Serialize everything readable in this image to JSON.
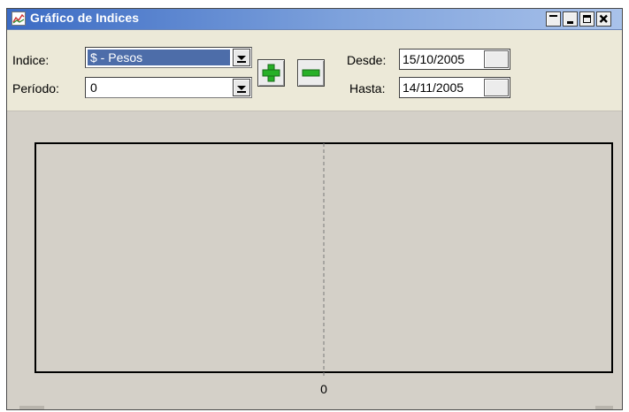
{
  "window": {
    "title": "Gráfico de Indices",
    "icon": "chart-icon"
  },
  "titlebar_buttons": [
    "restore-down-icon",
    "minimize-icon",
    "maximize-icon",
    "close-icon"
  ],
  "form": {
    "indice_label": "Indice:",
    "indice_value": "$ - Pesos",
    "periodo_label": "Período:",
    "periodo_value": "0",
    "add_icon": "plus-icon",
    "remove_icon": "minus-icon",
    "desde_label": "Desde:",
    "desde_value": "15/10/2005",
    "hasta_label": "Hasta:",
    "hasta_value": "14/11/2005"
  },
  "colors": {
    "titlebar_start": "#3b6bc4",
    "combo_selected": "#4d6da9",
    "button_icon_green": "#28b028",
    "chart_background": "#d4d0c8"
  },
  "chart_data": {
    "type": "line",
    "title": "",
    "xlabel": "",
    "ylabel": "",
    "x_ticks": [
      "0"
    ],
    "series": [],
    "grid": false,
    "reference_line_at_x": 0
  }
}
